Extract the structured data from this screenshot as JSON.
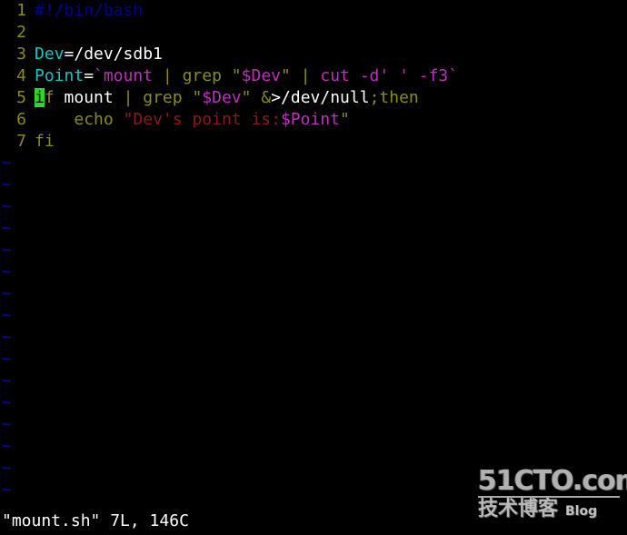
{
  "editor": {
    "name": "vim",
    "filename": "mount.sh",
    "background_color": "#000000",
    "line_number_color": "#8a8a1f",
    "tilde_color": "#0000cd",
    "cursor_color": "#2fd52f",
    "cursor_line": 5,
    "cursor_column": 1,
    "cursor_char": "i",
    "total_lines": 7,
    "lines": [
      {
        "number": "1",
        "text": "#!/bin/bash",
        "tokens": [
          {
            "text": "#!/bin/bash",
            "class": "tk-comment"
          }
        ]
      },
      {
        "number": "2",
        "text": "",
        "tokens": []
      },
      {
        "number": "3",
        "text": "Dev=/dev/sdb1",
        "tokens": [
          {
            "text": "Dev",
            "class": "tk-var"
          },
          {
            "text": "=/dev/sdb1",
            "class": "tk-plain"
          }
        ]
      },
      {
        "number": "4",
        "text": "Point=`mount | grep \"$Dev\" | cut -d' ' -f3`",
        "tokens": [
          {
            "text": "Point",
            "class": "tk-var"
          },
          {
            "text": "=",
            "class": "tk-plain"
          },
          {
            "text": "`",
            "class": "tk-cmd"
          },
          {
            "text": "mount",
            "class": "tk-cmd"
          },
          {
            "text": " ",
            "class": "tk-plain"
          },
          {
            "text": "|",
            "class": "tk-pipe"
          },
          {
            "text": " ",
            "class": "tk-plain"
          },
          {
            "text": "grep",
            "class": "tk-kw"
          },
          {
            "text": " ",
            "class": "tk-plain"
          },
          {
            "text": "\"",
            "class": "tk-str-y"
          },
          {
            "text": "$Dev",
            "class": "tk-dollar"
          },
          {
            "text": "\"",
            "class": "tk-str-y"
          },
          {
            "text": " ",
            "class": "tk-plain"
          },
          {
            "text": "|",
            "class": "tk-pipe"
          },
          {
            "text": " ",
            "class": "tk-plain"
          },
          {
            "text": "cut -d' ' -f3`",
            "class": "tk-cmd"
          }
        ]
      },
      {
        "number": "5",
        "text": "if mount | grep \"$Dev\" &>/dev/null;then",
        "tokens": [
          {
            "text": "i",
            "class": "tk-cursor"
          },
          {
            "text": "f",
            "class": "tk-kw"
          },
          {
            "text": " ",
            "class": "tk-plain"
          },
          {
            "text": "mount",
            "class": "tk-plain"
          },
          {
            "text": " ",
            "class": "tk-plain"
          },
          {
            "text": "|",
            "class": "tk-pipe"
          },
          {
            "text": " ",
            "class": "tk-plain"
          },
          {
            "text": "grep",
            "class": "tk-kw"
          },
          {
            "text": " ",
            "class": "tk-plain"
          },
          {
            "text": "\"",
            "class": "tk-str-y"
          },
          {
            "text": "$Dev",
            "class": "tk-dollar"
          },
          {
            "text": "\"",
            "class": "tk-str-y"
          },
          {
            "text": " ",
            "class": "tk-plain"
          },
          {
            "text": "&",
            "class": "tk-kw"
          },
          {
            "text": ">/dev/null",
            "class": "tk-plain"
          },
          {
            "text": ";",
            "class": "tk-kw"
          },
          {
            "text": "then",
            "class": "tk-kw"
          }
        ]
      },
      {
        "number": "6",
        "text": "    echo \"Dev's point is:$Point\"",
        "tokens": [
          {
            "text": "    ",
            "class": "tk-plain"
          },
          {
            "text": "echo",
            "class": "tk-kw"
          },
          {
            "text": " ",
            "class": "tk-plain"
          },
          {
            "text": "\"",
            "class": "tk-str-r"
          },
          {
            "text": "Dev's point is:",
            "class": "tk-str-r"
          },
          {
            "text": "$Point",
            "class": "tk-dollar"
          },
          {
            "text": "\"",
            "class": "tk-str-y"
          }
        ]
      },
      {
        "number": "7",
        "text": "fi",
        "tokens": [
          {
            "text": "fi",
            "class": "tk-kw"
          }
        ]
      }
    ],
    "tilde_rows": 16,
    "tilde_glyph": "~"
  },
  "status_line": {
    "text": "\"mount.sh\" 7L, 146C",
    "filename_quoted": "\"mount.sh\"",
    "line_count": "7L",
    "char_count": "146C"
  },
  "watermark": {
    "top": "51CTO.com",
    "bottom_cn": "技术博客",
    "bottom_en": "Blog"
  }
}
